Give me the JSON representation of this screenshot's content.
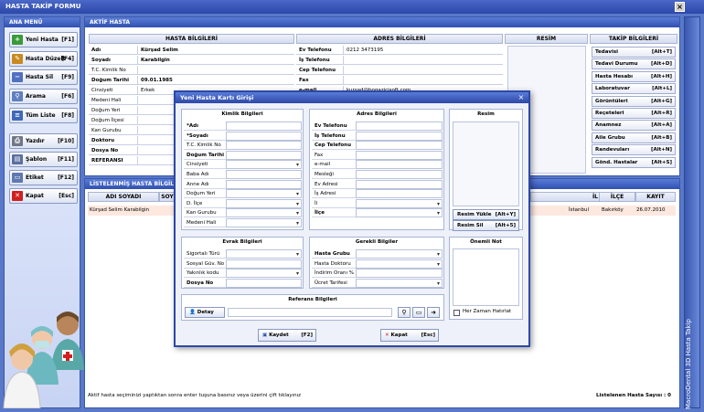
{
  "window": {
    "title": "HASTA TAKİP FORMU",
    "close": "×"
  },
  "menu": {
    "title": "ANA MENÜ",
    "items": [
      {
        "label": "Yeni Hasta",
        "key": "[F1]",
        "icon": "new-patient-icon",
        "color": "#3a9a3a",
        "glyph": "+"
      },
      {
        "label": "Hasta Düzelt",
        "key": "[F4]",
        "icon": "edit-icon",
        "color": "#c88a20",
        "glyph": "✎"
      },
      {
        "label": "Hasta Sil",
        "key": "[F9]",
        "icon": "delete-icon",
        "color": "#5070c0",
        "glyph": "−"
      },
      {
        "label": "Arama",
        "key": "[F6]",
        "icon": "search-icon",
        "color": "#6080c0",
        "glyph": "⚲"
      },
      {
        "label": "Tüm Liste",
        "key": "[F8]",
        "icon": "list-icon",
        "color": "#4068b8",
        "glyph": "≡"
      },
      {
        "label": "Yazdır",
        "key": "[F10]",
        "icon": "printer-icon",
        "color": "#707888",
        "glyph": "⎙"
      },
      {
        "label": "Şablon",
        "key": "[F11]",
        "icon": "template-icon",
        "color": "#5a70a0",
        "glyph": "▤"
      },
      {
        "label": "Etiket",
        "key": "[F12]",
        "icon": "label-icon",
        "color": "#6078b0",
        "glyph": "▭"
      },
      {
        "label": "Kapat",
        "key": "[Esc]",
        "icon": "close-icon",
        "color": "#d02020",
        "glyph": "✕"
      }
    ]
  },
  "aktif": {
    "title": "AKTİF HASTA",
    "headers": {
      "hasta": "HASTA BİLGİLERİ",
      "adres": "ADRES BİLGİLERİ",
      "resim": "RESİM",
      "takip": "TAKİP BİLGİLERİ"
    },
    "fields": [
      {
        "label": "Adı",
        "value": "Kürşad Selim",
        "bold": true
      },
      {
        "label": "Soyadı",
        "value": "Karabilgin",
        "bold": true
      },
      {
        "label": "T.C. Kimlik No",
        "value": "",
        "bold": false
      },
      {
        "label": "Doğum Tarihi",
        "value": "09.01.1985",
        "bold": true
      },
      {
        "label": "Cinsiyeti",
        "value": "Erkek",
        "bold": false
      },
      {
        "label": "Medeni Hali",
        "value": "",
        "bold": false
      },
      {
        "label": "Doğum Yeri",
        "value": "",
        "bold": false
      },
      {
        "label": "Doğum İlçesi",
        "value": "",
        "bold": false
      },
      {
        "label": "Kan Gurubu",
        "value": "",
        "bold": false
      },
      {
        "label": "Doktoru",
        "value": "",
        "bold": true
      },
      {
        "label": "Dosya No",
        "value": "",
        "bold": true
      },
      {
        "label": "REFERANSI",
        "value": "",
        "bold": true
      }
    ],
    "address": [
      {
        "label": "Ev Telefonu",
        "value": "0212 3473195"
      },
      {
        "label": "İş Telefonu",
        "value": ""
      },
      {
        "label": "Cep Telefonu",
        "value": ""
      },
      {
        "label": "Fax",
        "value": ""
      },
      {
        "label": "e-mail",
        "value": "kursad@bogazicisoft.com"
      }
    ],
    "takip": [
      {
        "label": "Tedavisi",
        "key": "[Alt+T]"
      },
      {
        "label": "Tedavi Durumu",
        "key": "[Alt+D]"
      },
      {
        "label": "Hasta Hesabı",
        "key": "[Alt+H]"
      },
      {
        "label": "Laboratuvar",
        "key": "[Alt+L]"
      },
      {
        "label": "Görüntüleri",
        "key": "[Alt+G]"
      },
      {
        "label": "Reçeteleri",
        "key": "[Alt+R]"
      },
      {
        "label": "Anamnez",
        "key": "[Alt+A]"
      },
      {
        "label": "Aile Grubu",
        "key": "[Alt+B]"
      },
      {
        "label": "Randevuları",
        "key": "[Alt+N]"
      },
      {
        "label": "Gönd. Hastalar",
        "key": "[Alt+S]"
      }
    ]
  },
  "liste": {
    "title": "LİSTELENMİŞ HASTA BİLGİLERİ",
    "columns": {
      "adi": "ADI SOYADI",
      "soy": "SOY",
      "il": "İL",
      "ilce": "İLÇE",
      "kayit": "KAYIT"
    },
    "rows": [
      {
        "adi": "Kürşad Selim Karabilgin",
        "il": "İstanbul",
        "ilce": "Bakırköy",
        "kayit": "26.07.2010"
      }
    ],
    "status": "Aktif hasta seçiminizi yaptıktan sonra enter tuşuna basınız veya üzerini çift tıklayınız",
    "count": "Listelenen Hasta Sayısı : 0"
  },
  "sidebar_text": "MacroDental 3D Hasta Takip",
  "dialog": {
    "title": "Yeni Hasta Kartı Girişi",
    "close": "×",
    "kimlik": {
      "title": "Kimlik Bilgileri",
      "fields": [
        {
          "label": "*Adı",
          "bold": true,
          "dd": false
        },
        {
          "label": "*Soyadı",
          "bold": true,
          "dd": false
        },
        {
          "label": "T.C. Kimlik No",
          "bold": false,
          "dd": false
        },
        {
          "label": "Doğum Tarihi",
          "bold": true,
          "dd": false
        },
        {
          "label": "Cinsiyeti",
          "bold": false,
          "dd": true
        },
        {
          "label": "Baba Adı",
          "bold": false,
          "dd": false
        },
        {
          "label": "Anne Adı",
          "bold": false,
          "dd": false
        },
        {
          "label": "Doğum Yeri",
          "bold": false,
          "dd": true
        },
        {
          "label": "D. İlçe",
          "bold": false,
          "dd": true
        },
        {
          "label": "Kan Gurubu",
          "bold": false,
          "dd": true
        },
        {
          "label": "Medeni Hali",
          "bold": false,
          "dd": true
        }
      ]
    },
    "adres": {
      "title": "Adres Bilgileri",
      "fields": [
        {
          "label": "Ev Telefonu",
          "bold": true,
          "dd": false
        },
        {
          "label": "İş Telefonu",
          "bold": true,
          "dd": false
        },
        {
          "label": "Cep Telefonu",
          "bold": true,
          "dd": false
        },
        {
          "label": "Fax",
          "bold": false,
          "dd": false
        },
        {
          "label": "e-mail",
          "bold": false,
          "dd": false
        },
        {
          "label": "Mesleği",
          "bold": false,
          "dd": false
        },
        {
          "label": "Ev Adresi",
          "bold": false,
          "dd": false
        },
        {
          "label": "İş Adresi",
          "bold": false,
          "dd": false
        },
        {
          "label": "İl",
          "bold": false,
          "dd": true
        },
        {
          "label": "İlçe",
          "bold": true,
          "dd": true
        }
      ]
    },
    "resim": {
      "title": "Resim",
      "load": "Resim Yükle",
      "load_key": "[Alt+Y]",
      "del": "Resim Sil",
      "del_key": "[Alt+5]"
    },
    "evrak": {
      "title": "Evrak Bilgileri",
      "fields": [
        {
          "label": "Sigortalı Türü",
          "bold": false,
          "dd": true
        },
        {
          "label": "Sosyal Güv. No",
          "bold": false,
          "dd": false
        },
        {
          "label": "Yakınlık kodu",
          "bold": false,
          "dd": true
        },
        {
          "label": "Dosya No",
          "bold": true,
          "dd": false
        }
      ]
    },
    "gerekli": {
      "title": "Gerekli Bilgiler",
      "fields": [
        {
          "label": "Hasta Grubu",
          "bold": true,
          "dd": true
        },
        {
          "label": "Hasta Doktoru",
          "bold": false,
          "dd": true
        },
        {
          "label": "İndirim Oranı %",
          "bold": false,
          "dd": false
        },
        {
          "label": "Ücret Tarifesi",
          "bold": false,
          "dd": true
        }
      ]
    },
    "not": {
      "title": "Önemli Not",
      "remember": "Her Zaman Hatırlat"
    },
    "referans": {
      "title": "Referans Bilgileri",
      "detay": "Detay"
    },
    "kaydet": "Kaydet",
    "kaydet_key": "[F2]",
    "kapat": "Kapat",
    "kapat_key": "[Esc]"
  }
}
